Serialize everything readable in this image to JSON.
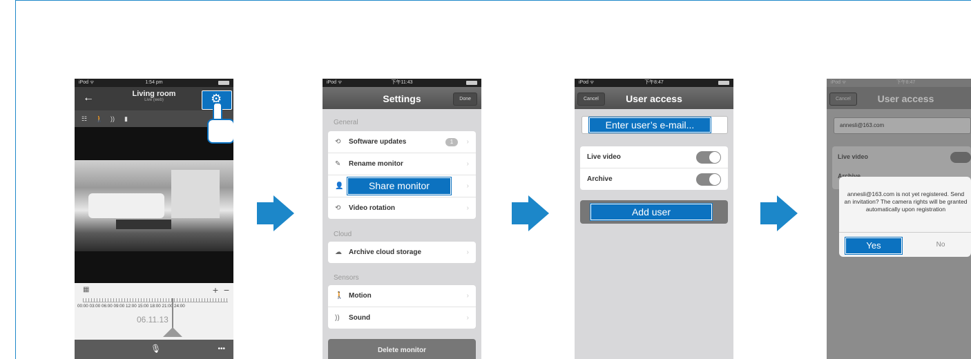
{
  "colors": {
    "accent": "#0c72c0",
    "frame": "#1c87c9"
  },
  "screen1": {
    "status": {
      "left": "iPod ᯤ",
      "time": "1:54 pm"
    },
    "title": "Living room",
    "subtitle": "Live (web)",
    "back_icon": "arrow-left-icon",
    "settings_icon": "gear-icon",
    "toolbar_icons": [
      "sliders-icon",
      "walk-icon",
      "sound-icon",
      "plug-icon"
    ],
    "timeline": {
      "ticks": "00:00 03:00 06:00 09:00 12:00 15:00 18:00 21:00 24:00",
      "date": "06.11.13",
      "zoom_in": "+",
      "zoom_out": "−"
    },
    "more": "•••"
  },
  "screen2": {
    "status": {
      "left": "iPod ᯤ",
      "time": "下午11:43"
    },
    "title": "Settings",
    "done": "Done",
    "general_label": "General",
    "items_general": [
      "Software updates",
      "Rename monitor",
      "Share monitor",
      "Video rotation"
    ],
    "badge": "1",
    "cloud_label": "Cloud",
    "cloud_item": "Archive cloud storage",
    "sensors_label": "Sensors",
    "sensor_items": [
      "Motion",
      "Sound"
    ],
    "delete": "Delete monitor"
  },
  "screen3": {
    "status": {
      "left": "iPod ᯤ",
      "time": "下午8:47"
    },
    "title": "User access",
    "cancel": "Cancel",
    "email_placeholder": "Enter user’s e-mail...",
    "live_video": "Live video",
    "archive": "Archive",
    "add_user": "Add user"
  },
  "screen4": {
    "status": {
      "left": "iPod ᯤ",
      "time": "下午8:47"
    },
    "title": "User access",
    "cancel": "Cancel",
    "email": "annesli@163.com",
    "live_video": "Live video",
    "archive": "Archive",
    "alert_message": "annesli@163.com is not yet registered. Send an invitation? The camera rights will be granted automatically upon registration",
    "yes": "Yes",
    "no": "No"
  }
}
